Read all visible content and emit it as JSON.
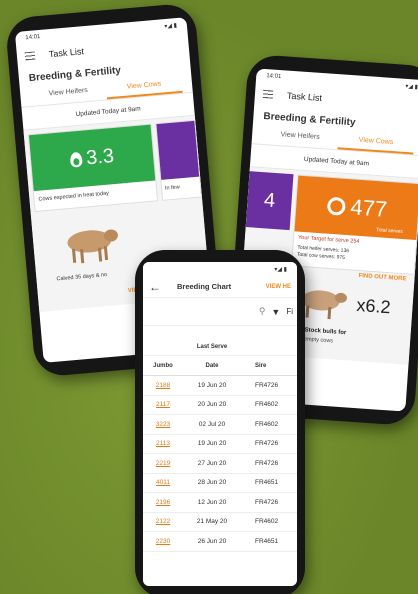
{
  "colors": {
    "background": "#6f8c2c",
    "accent": "#f08a1c",
    "green_tile": "#2da84a",
    "purple_tile": "#6a2fa0",
    "orange_tile": "#ec7a16"
  },
  "left_phone": {
    "status_time": "14:01",
    "app_title": "Task List",
    "section_title": "Breeding & Fertility",
    "tabs": [
      "View Heifers",
      "View Cows"
    ],
    "updated": "Updated Today at 9am",
    "tile_value": "3.3",
    "tile_caption": "Cows expected in heat today",
    "side_tile_caption": "In few",
    "cow_caption": "Calved 35 days & no",
    "cow_link": "VIEW"
  },
  "right_phone": {
    "status_time": "14:01",
    "app_title": "Task List",
    "section_title": "Breeding & Fertility",
    "tabs": [
      "View Heifers",
      "View Cows"
    ],
    "updated": "Updated Today at 9am",
    "left_tile_value": "4",
    "tile_value": "477",
    "tile_caption": "Total serves",
    "note": "Your Target for serve 254",
    "stat1": "Total heifer serves: 136",
    "stat2": "Total cow serves: 975",
    "link": "FIND OUT MORE",
    "multiplier": "x6.2",
    "stock_bulls": "Stock bulls for",
    "stock_bulls2": "empty cows"
  },
  "front_phone": {
    "app_title": "Breeding Chart",
    "header_link": "VIEW HE",
    "filter_label": "Fi",
    "group_header": "Last Serve",
    "columns": [
      "Jumbo",
      "Date",
      "Sire"
    ],
    "rows": [
      {
        "id": "2188",
        "date": "19 Jun 20",
        "sire": "FR4726"
      },
      {
        "id": "2117",
        "date": "20 Jun 20",
        "sire": "FR4602"
      },
      {
        "id": "3223",
        "date": "02 Jul 20",
        "sire": "FR4602"
      },
      {
        "id": "2113",
        "date": "19 Jun 20",
        "sire": "FR4726"
      },
      {
        "id": "2219",
        "date": "27 Jun 20",
        "sire": "FR4726"
      },
      {
        "id": "4011",
        "date": "28 Jun 20",
        "sire": "FR4651"
      },
      {
        "id": "2196",
        "date": "12 Jun 20",
        "sire": "FR4726"
      },
      {
        "id": "2122",
        "date": "21 May 20",
        "sire": "FR4602"
      },
      {
        "id": "2230",
        "date": "26 Jun 20",
        "sire": "FR4651"
      }
    ]
  }
}
